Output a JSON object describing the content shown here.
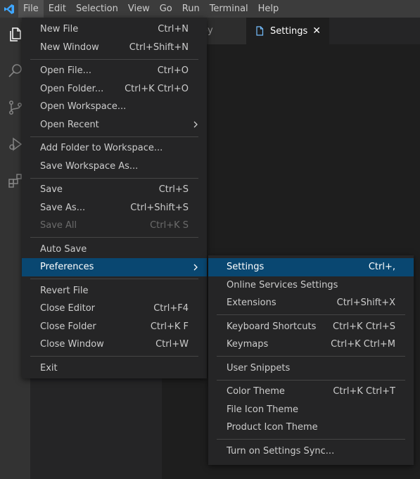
{
  "colors": {
    "titlebar": "#3c3c3c",
    "activitybar": "#333333",
    "sidebar": "#252526",
    "editor": "#1e1e1e",
    "menu_bg": "#252526",
    "menu_highlight": "#094771",
    "vscode_blue": "#3ea6ff"
  },
  "menubar": {
    "app_icon": "vscode-logo-icon",
    "items": [
      "File",
      "Edit",
      "Selection",
      "View",
      "Go",
      "Run",
      "Terminal",
      "Help"
    ]
  },
  "activitybar": {
    "icons": [
      "explorer-icon",
      "search-icon",
      "source-control-icon",
      "run-debug-icon",
      "extensions-icon"
    ]
  },
  "tabs": {
    "inactive_fragment": "oy",
    "active": {
      "label": "Settings",
      "icon": "file-icon",
      "close": "✕"
    }
  },
  "file_menu": {
    "groups": [
      [
        {
          "label": "New File",
          "shortcut": "Ctrl+N"
        },
        {
          "label": "New Window",
          "shortcut": "Ctrl+Shift+N"
        }
      ],
      [
        {
          "label": "Open File...",
          "shortcut": "Ctrl+O"
        },
        {
          "label": "Open Folder...",
          "shortcut": "Ctrl+K Ctrl+O"
        },
        {
          "label": "Open Workspace...",
          "shortcut": ""
        },
        {
          "label": "Open Recent",
          "shortcut": "",
          "submenu": true
        }
      ],
      [
        {
          "label": "Add Folder to Workspace...",
          "shortcut": ""
        },
        {
          "label": "Save Workspace As...",
          "shortcut": ""
        }
      ],
      [
        {
          "label": "Save",
          "shortcut": "Ctrl+S"
        },
        {
          "label": "Save As...",
          "shortcut": "Ctrl+Shift+S"
        },
        {
          "label": "Save All",
          "shortcut": "Ctrl+K S",
          "disabled": true
        }
      ],
      [
        {
          "label": "Auto Save",
          "shortcut": ""
        },
        {
          "label": "Preferences",
          "shortcut": "",
          "submenu": true,
          "highlighted": true
        }
      ],
      [
        {
          "label": "Revert File",
          "shortcut": ""
        },
        {
          "label": "Close Editor",
          "shortcut": "Ctrl+F4"
        },
        {
          "label": "Close Folder",
          "shortcut": "Ctrl+K F"
        },
        {
          "label": "Close Window",
          "shortcut": "Ctrl+W"
        }
      ],
      [
        {
          "label": "Exit",
          "shortcut": ""
        }
      ]
    ]
  },
  "preferences_menu": {
    "groups": [
      [
        {
          "label": "Settings",
          "shortcut": "Ctrl+,",
          "highlighted": true
        },
        {
          "label": "Online Services Settings",
          "shortcut": ""
        },
        {
          "label": "Extensions",
          "shortcut": "Ctrl+Shift+X"
        }
      ],
      [
        {
          "label": "Keyboard Shortcuts",
          "shortcut": "Ctrl+K Ctrl+S"
        },
        {
          "label": "Keymaps",
          "shortcut": "Ctrl+K Ctrl+M"
        }
      ],
      [
        {
          "label": "User Snippets",
          "shortcut": ""
        }
      ],
      [
        {
          "label": "Color Theme",
          "shortcut": "Ctrl+K Ctrl+T"
        },
        {
          "label": "File Icon Theme",
          "shortcut": ""
        },
        {
          "label": "Product Icon Theme",
          "shortcut": ""
        }
      ],
      [
        {
          "label": "Turn on Settings Sync...",
          "shortcut": ""
        }
      ]
    ]
  }
}
